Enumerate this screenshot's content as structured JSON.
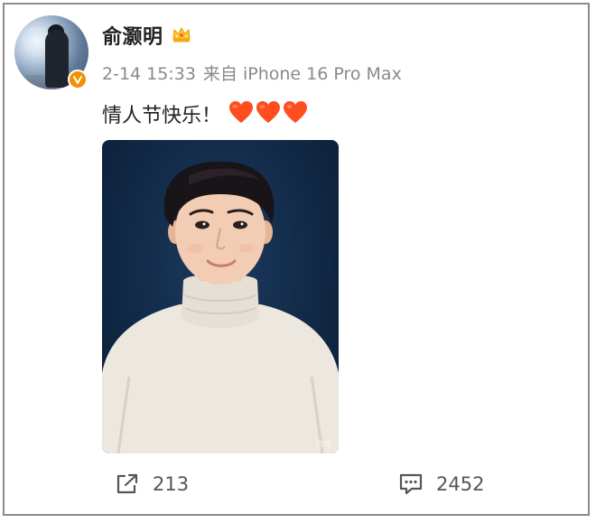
{
  "post": {
    "author": "俞灏明",
    "date": "2-14 15:33",
    "source": "来自 iPhone 16 Pro Max",
    "text": "情人节快乐！",
    "photo_watermark": "微博"
  },
  "icons": {
    "author_badge": "crown-icon",
    "verified": "verified-badge-icon",
    "heart": "heart-emoji-icon",
    "repost": "repost-icon",
    "comment": "comment-icon"
  },
  "actions": {
    "reposts": "213",
    "comments": "2452"
  },
  "colors": {
    "verified_badge": "#f39000",
    "heart": "#ff4d1f",
    "meta_text": "#8a8a8a"
  }
}
